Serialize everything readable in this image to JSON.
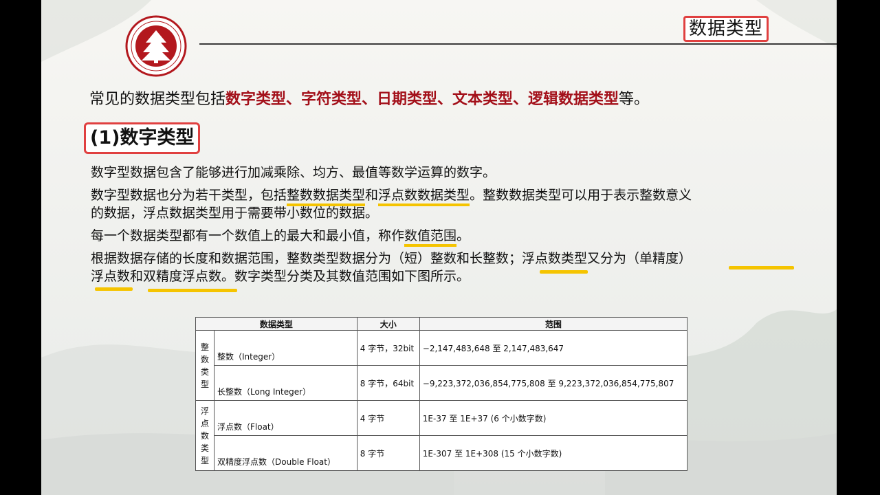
{
  "slide_title": "数据类型",
  "intro": {
    "prefix": "常见的数据类型包括",
    "highlight": "数字类型、字符类型、日期类型、文本类型、逻辑数据类型",
    "suffix": "等。"
  },
  "section_title": "(1)数字类型",
  "paragraphs": {
    "p1": "数字型数据包含了能够进行加减乘除、均方、最值等数学运算的数字。",
    "p2": {
      "a": "数字型数据也分为若干类型，包括",
      "b": "整数数据类型",
      "c": "和",
      "d": "浮点数数据类型",
      "e": "。整数数据类型可以用于表示整数意义",
      "f": "的数据，浮点数据类型用于需要带小数位的数据。"
    },
    "p3": {
      "a": "每一个数据类型都有一个数值上的最大和最小值，称作",
      "b": "数值范围",
      "c": "。"
    },
    "p4": {
      "line1": "根据数据存储的长度和数据范围，整数类型数据分为（短）整数和长整数；浮点数类型又分为（单精度）",
      "line2": "浮点数和双精度浮点数。数字类型分类及其数值范围如下图所示。"
    }
  },
  "table": {
    "headers": [
      "数据类型",
      "大小",
      "范围"
    ],
    "groups": [
      {
        "label": [
          "整",
          "数",
          "类",
          "型"
        ]
      },
      {
        "label": [
          "浮",
          "点",
          "数",
          "类",
          "型"
        ]
      }
    ],
    "rows": [
      {
        "name": "整数（Integer）",
        "size": "4 字节，32bit",
        "range": "−2,147,483,648 至 2,147,483,647"
      },
      {
        "name": "长整数（Long Integer）",
        "size": "8 字节，64bit",
        "range": "−9,223,372,036,854,775,808 至 9,223,372,036,854,775,807"
      },
      {
        "name": "浮点数（Float）",
        "size": "4 字节",
        "range": "1E-37 至 1E+37 (6 个小数字数)"
      },
      {
        "name": "双精度浮点数（Double Float）",
        "size": "8 字节",
        "range": "1E-307 至 1E+308 (15 个小数字数)"
      }
    ]
  },
  "colors": {
    "accent_red": "#a3101a",
    "box_border": "#e04040",
    "marker": "#f5c400"
  }
}
